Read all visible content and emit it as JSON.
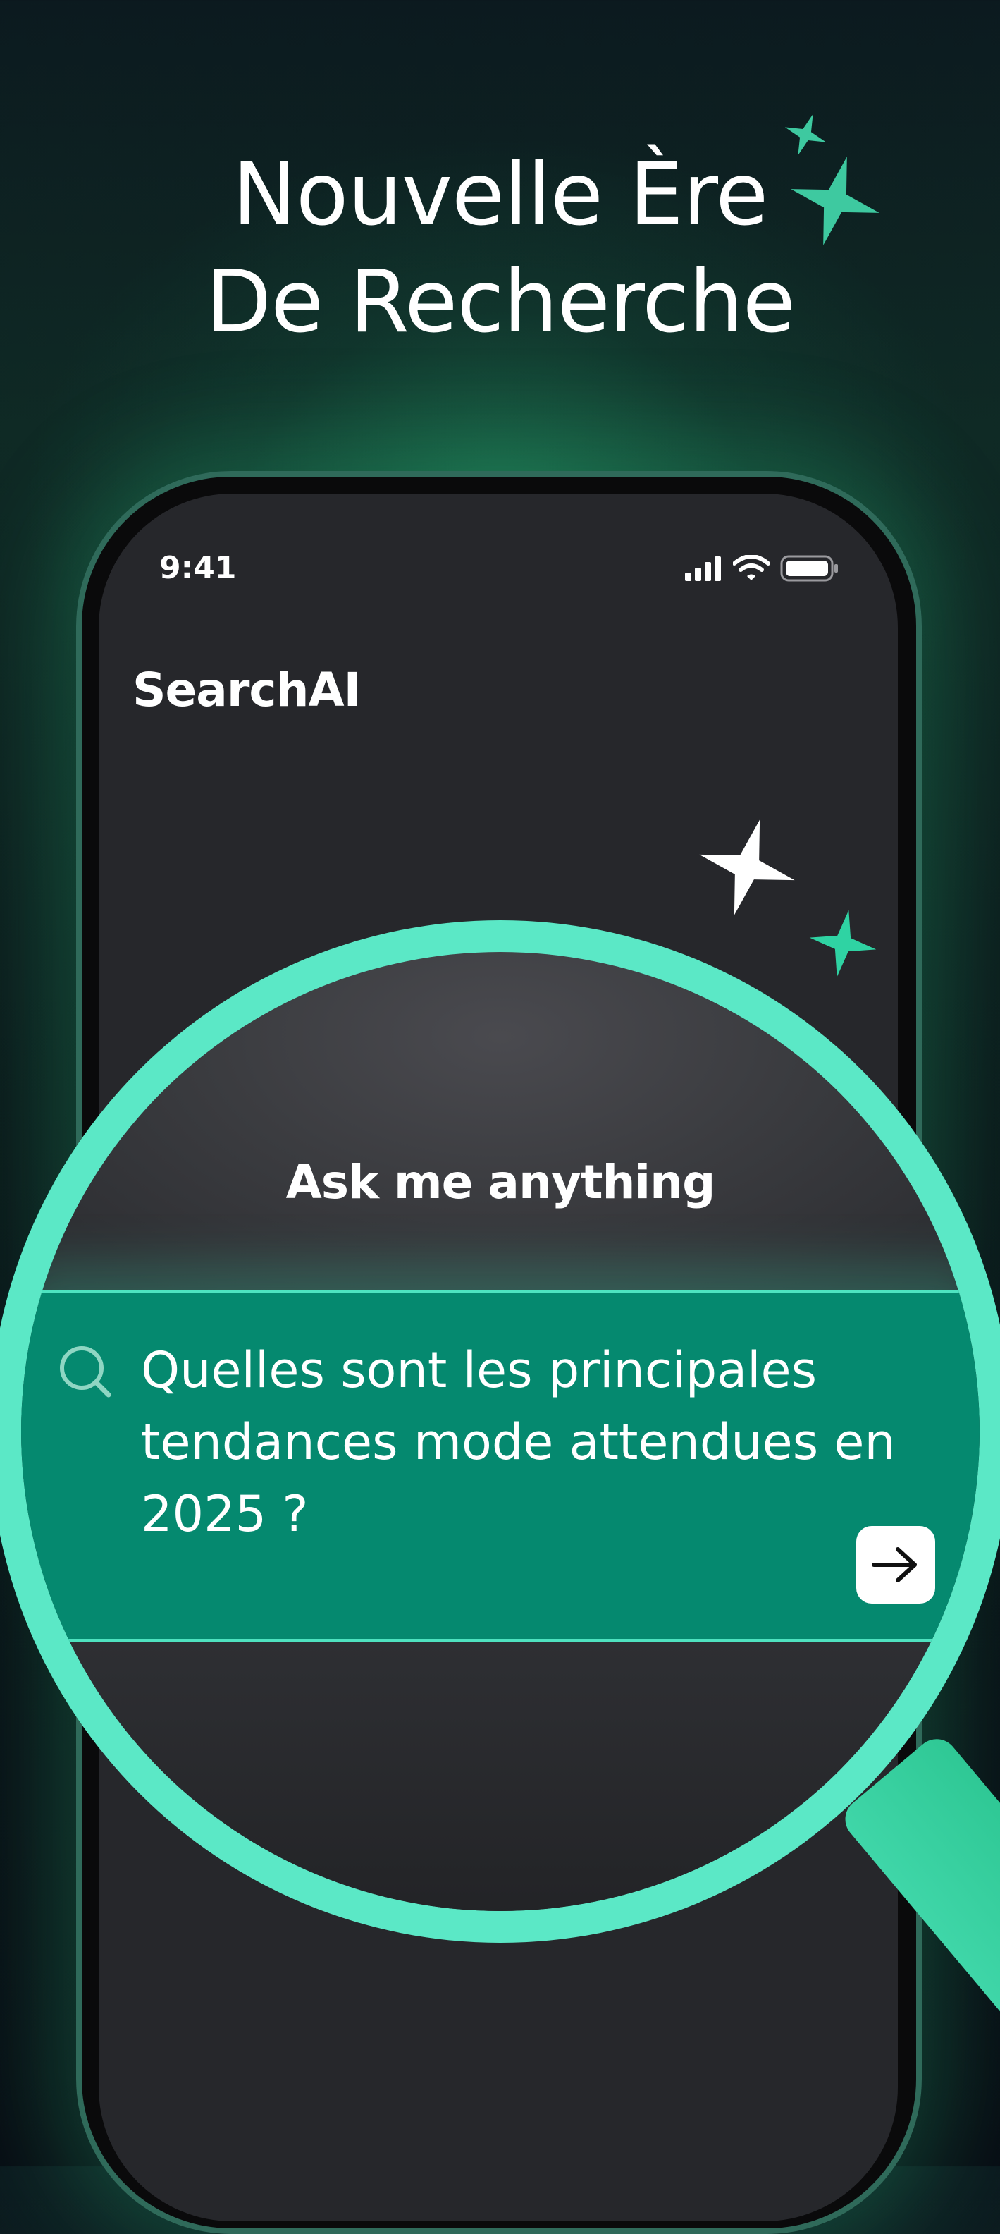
{
  "headline": {
    "line1": "Nouvelle Ère",
    "line2": "De Recherche"
  },
  "status_bar": {
    "time": "9:41"
  },
  "app": {
    "title": "SearchAI",
    "prompt_title": "Ask me anything",
    "query": "Quelles sont les principales tendances mode attendues en 2025 ?"
  },
  "colors": {
    "accent": "#5be8c6",
    "band": "#05896f",
    "screen": "#26272b"
  },
  "icons": [
    "sparkle-icon",
    "search-icon",
    "arrow-right-icon",
    "signal-icon",
    "wifi-icon",
    "battery-icon"
  ]
}
